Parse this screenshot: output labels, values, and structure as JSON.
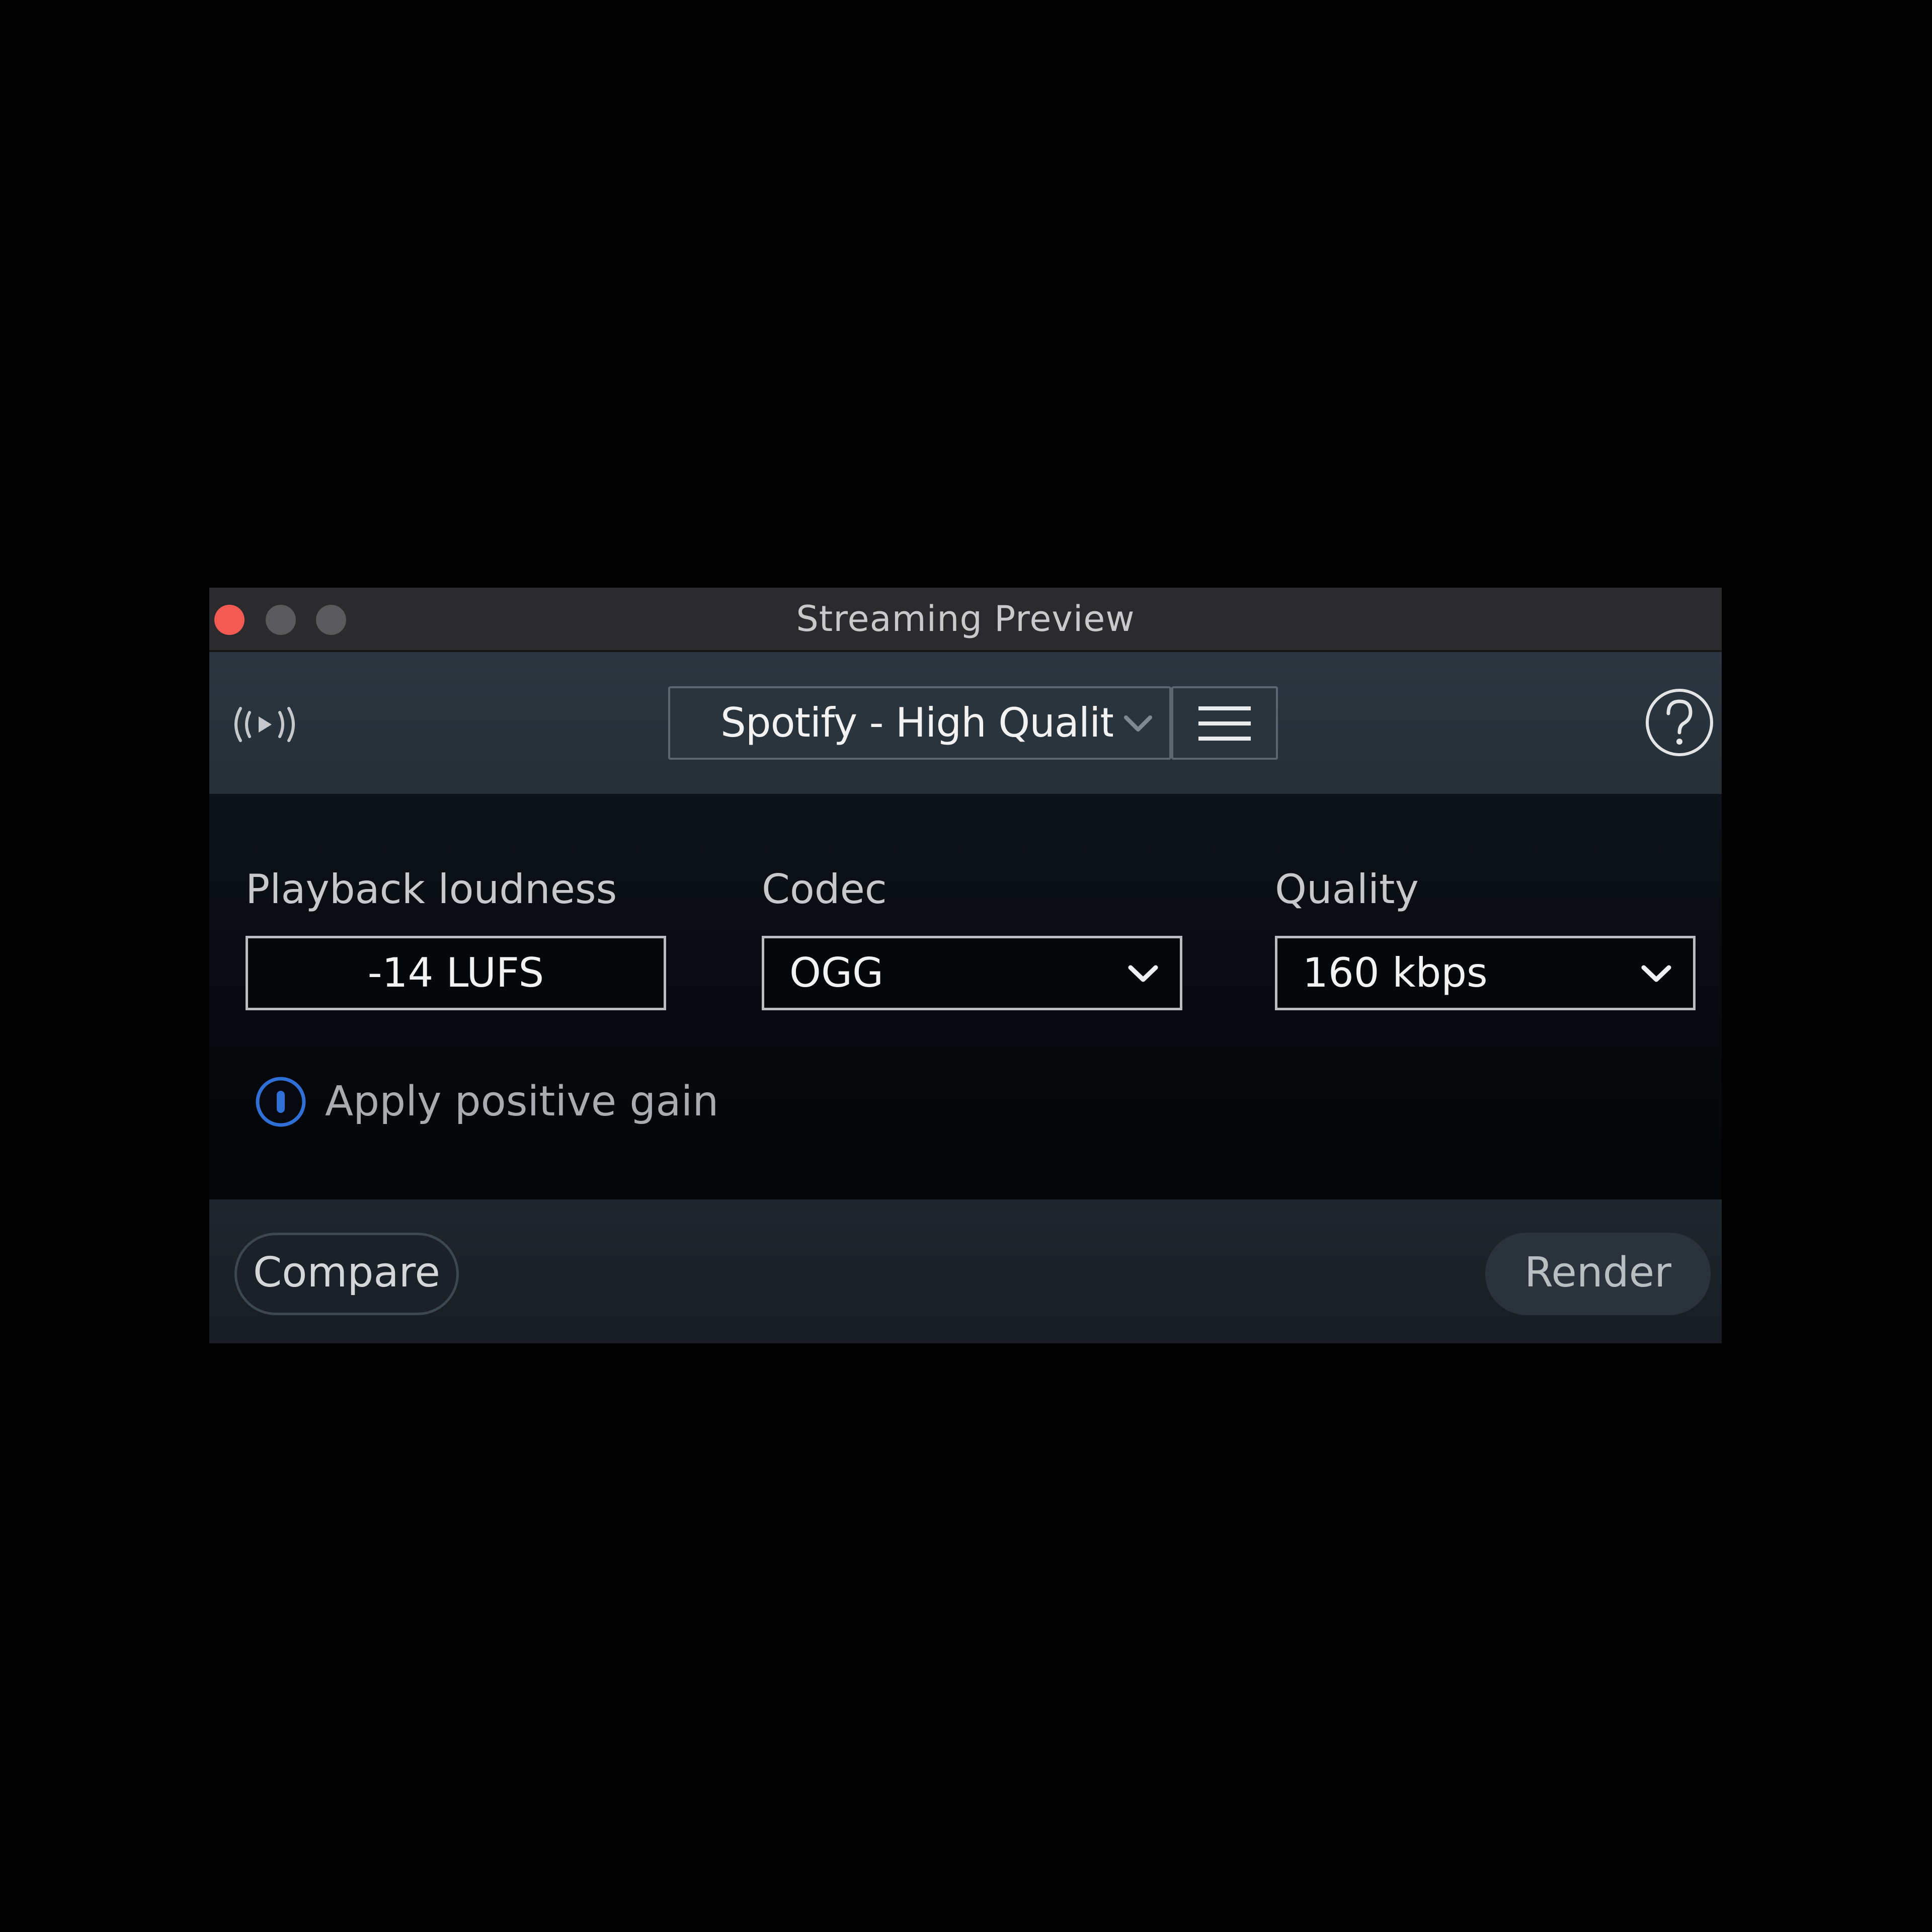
{
  "window": {
    "title": "Streaming Preview"
  },
  "toolbar": {
    "preset_label": "Spotify - High Quality",
    "icons": {
      "stream": "streaming-play-icon",
      "chevron": "chevron-down-icon",
      "menu": "hamburger-menu-icon",
      "help": "question-mark-icon"
    }
  },
  "fields": {
    "loudness": {
      "label": "Playback loudness",
      "value": "-14  LUFS"
    },
    "codec": {
      "label": "Codec",
      "value": "OGG"
    },
    "quality": {
      "label": "Quality",
      "value": "160 kbps"
    }
  },
  "toggle": {
    "label": "Apply positive gain",
    "state": "off"
  },
  "footer": {
    "compare_label": "Compare",
    "render_label": "Render"
  },
  "colors": {
    "close": "#f25a52",
    "toggle_accent": "#2f6fd6",
    "field_border": "#b9bcc0"
  }
}
